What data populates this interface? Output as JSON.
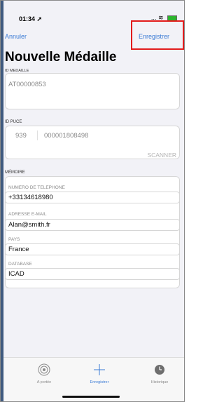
{
  "status": {
    "time": "01:34",
    "signal": "..."
  },
  "nav": {
    "left": "Annuler",
    "right": "Enregistrer"
  },
  "title": "Nouvelle Médaille",
  "id_medaille": {
    "label": "ID MEDAILLE",
    "value": "AT00000853"
  },
  "id_puce": {
    "label": "ID PUCE",
    "prefix": "939",
    "number": "000001808498",
    "scan": "SCANNER"
  },
  "memoire": {
    "label": "MÉMOIRE",
    "fields": [
      {
        "label": "NUMERO DE TELEPHONE",
        "value": "+33134618980"
      },
      {
        "label": "ADRESSE E-MAIL",
        "value": "Alan@smith.fr"
      },
      {
        "label": "PAYS",
        "value": "France"
      },
      {
        "label": "DATABASE",
        "value": "ICAD"
      }
    ]
  },
  "tabs": [
    {
      "label": "A portée",
      "icon": "radar-icon"
    },
    {
      "label": "Enregistrer",
      "icon": "plus-icon"
    },
    {
      "label": "Historique",
      "icon": "clock-icon"
    }
  ]
}
